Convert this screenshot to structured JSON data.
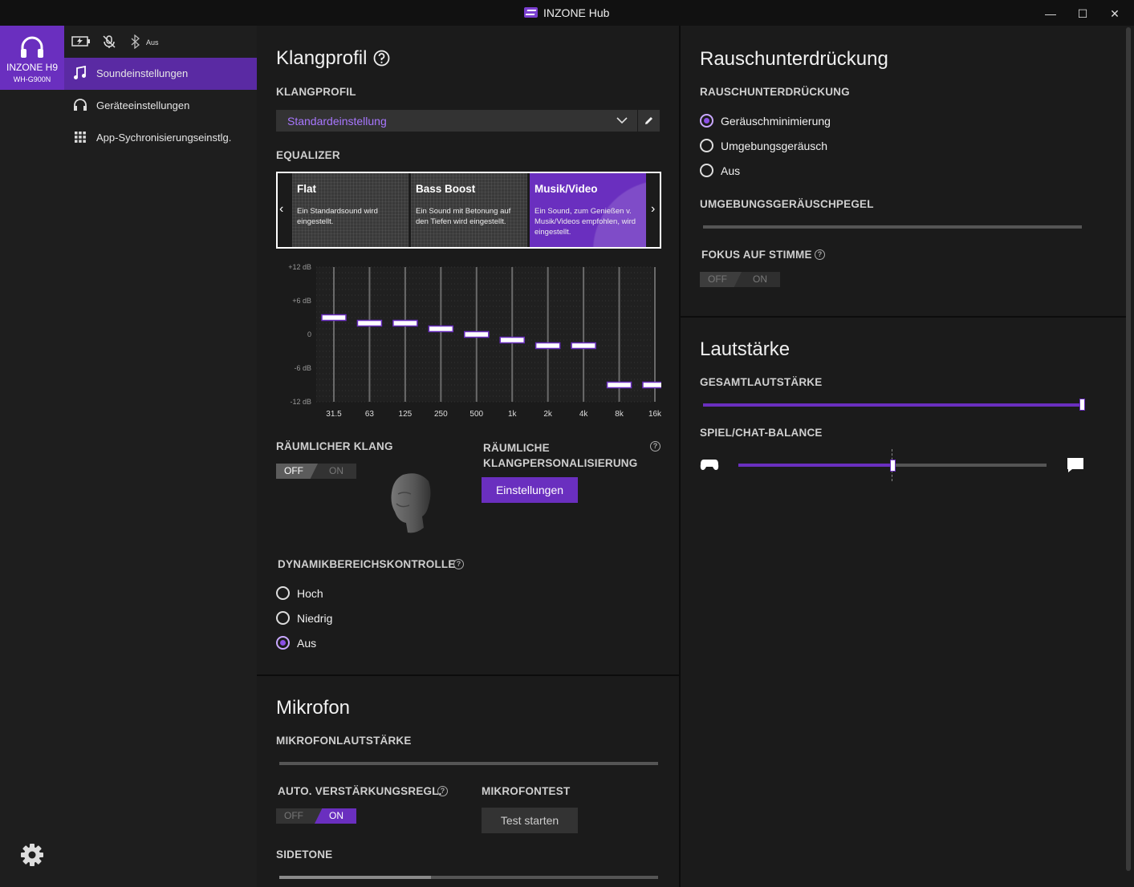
{
  "window": {
    "title": "INZONE Hub",
    "minimize": "—",
    "maximize": "☐",
    "close": "✕"
  },
  "device": {
    "name": "INZONE H9",
    "model": "WH-G900N",
    "bluetooth_status": "Aus"
  },
  "nav": {
    "items": [
      {
        "label": "Soundeinstellungen",
        "icon": "music-note-icon",
        "active": true
      },
      {
        "label": "Geräteeinstellungen",
        "icon": "headphones-icon",
        "active": false
      },
      {
        "label": "App-Sychronisierungseinstlg.",
        "icon": "grid-icon",
        "active": false
      }
    ]
  },
  "klangprofil": {
    "title": "Klangprofil",
    "profile_label": "KLANGPROFIL",
    "profile_value": "Standardeinstellung",
    "equalizer_label": "EQUALIZER",
    "presets": [
      {
        "title": "Flat",
        "desc": "Ein Standardsound wird eingestellt."
      },
      {
        "title": "Bass Boost",
        "desc": "Ein Sound mit Betonung auf den Tiefen wird eingestellt."
      },
      {
        "title": "Musik/Video",
        "desc": "Ein Sound, zum Genießen v. Musik/Videos empfohlen, wird eingestellt."
      }
    ],
    "selected_preset": "Musik/Video",
    "eq": {
      "y_labels": [
        "+12 dB",
        "+6 dB",
        "0",
        "-6 dB",
        "-12 dB"
      ],
      "bands": [
        "31.5",
        "63",
        "125",
        "250",
        "500",
        "1k",
        "2k",
        "4k",
        "8k",
        "16k"
      ],
      "values": [
        3,
        2,
        2,
        1,
        0,
        -1,
        -2,
        -2,
        -9,
        -9
      ],
      "range": [
        -12,
        12
      ]
    },
    "spatial_label": "RÄUMLICHER KLANG",
    "spatial_off": "OFF",
    "spatial_on": "ON",
    "personal_label": "RÄUMLICHE KLANGPERSONALISIERUNG",
    "settings_button": "Einstellungen",
    "dynamic_label": "DYNAMIKBEREICHSKONTROLLE",
    "dynamic_options": [
      "Hoch",
      "Niedrig",
      "Aus"
    ],
    "dynamic_selected": "Aus"
  },
  "mikrofon": {
    "title": "Mikrofon",
    "volume_label": "MIKROFONLAUTSTÄRKE",
    "agc_label": "AUTO. VERSTÄRKUNGSREGL.",
    "agc_off": "OFF",
    "agc_on": "ON",
    "test_label": "MIKROFONTEST",
    "test_button": "Test starten",
    "sidetone_label": "SIDETONE",
    "sidetone_level": 0.4
  },
  "rausch": {
    "title": "Rauschunterdrückung",
    "label": "RAUSCHUNTERDRÜCKUNG",
    "options": [
      "Geräuschminimierung",
      "Umgebungsgeräusch",
      "Aus"
    ],
    "selected": "Geräuschminimierung",
    "ambient_label": "UMGEBUNGSGERÄUSCHPEGEL",
    "focus_label": "FOKUS AUF STIMME",
    "focus_off": "OFF",
    "focus_on": "ON"
  },
  "lautstaerke": {
    "title": "Lautstärke",
    "total_label": "GESAMTLAUTSTÄRKE",
    "total_level": 1.0,
    "balance_label": "SPIEL/CHAT-BALANCE",
    "balance_level": 0.5
  },
  "colors": {
    "accent": "#6a2fbf",
    "accent_text": "#a877ff",
    "background": "#1b1b1b"
  }
}
